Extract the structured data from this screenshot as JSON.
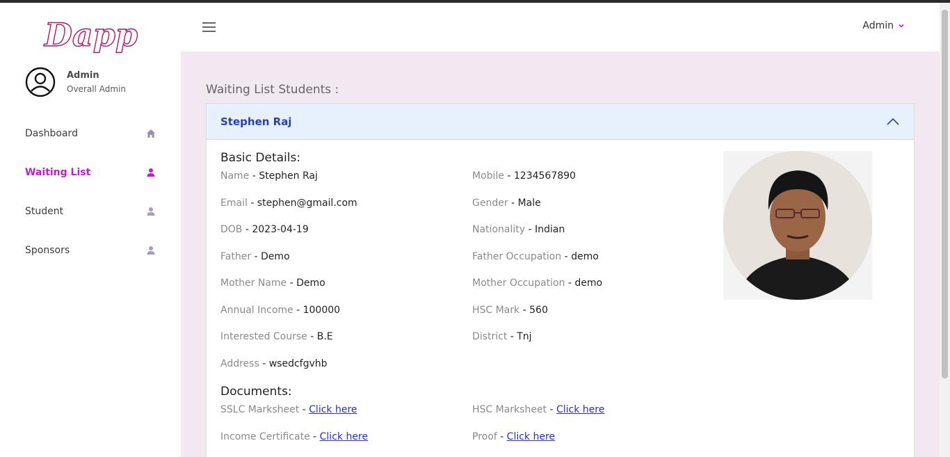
{
  "logo": {
    "text": "Dapp"
  },
  "profile": {
    "name": "Admin",
    "role": "Overall Admin"
  },
  "nav": {
    "items": [
      {
        "label": "Dashboard",
        "icon": "home-icon",
        "active": false
      },
      {
        "label": "Waiting List",
        "icon": "user-icon",
        "active": true
      },
      {
        "label": "Student",
        "icon": "user-icon",
        "active": false
      },
      {
        "label": "Sponsors",
        "icon": "user-icon",
        "active": false
      }
    ]
  },
  "header": {
    "user_label": "Admin"
  },
  "page": {
    "title": "Waiting List Students :"
  },
  "student": {
    "name": "Stephen Raj",
    "basic_title": "Basic Details:",
    "details": [
      {
        "label": "Name",
        "value": "Stephen Raj"
      },
      {
        "label": "Mobile",
        "value": "1234567890"
      },
      {
        "label": "Email",
        "value": "stephen@gmail.com"
      },
      {
        "label": "Gender",
        "value": "Male"
      },
      {
        "label": "DOB",
        "value": "2023-04-19"
      },
      {
        "label": "Nationality",
        "value": "Indian"
      },
      {
        "label": "Father",
        "value": "Demo"
      },
      {
        "label": "Father Occupation",
        "value": "demo"
      },
      {
        "label": "Mother Name",
        "value": "Demo"
      },
      {
        "label": "Mother Occupation",
        "value": "demo"
      },
      {
        "label": "Annual Income",
        "value": "100000"
      },
      {
        "label": "HSC Mark",
        "value": "560"
      },
      {
        "label": "Interested Course",
        "value": "B.E"
      },
      {
        "label": "District",
        "value": "Tnj"
      },
      {
        "label": "Address",
        "value": "wsedcfgvhb"
      }
    ],
    "documents_title": "Documents:",
    "documents": [
      {
        "label": "SSLC Marksheet",
        "link": "Click here"
      },
      {
        "label": "HSC Marksheet",
        "link": "Click here"
      },
      {
        "label": "Income Certificate",
        "link": "Click here"
      },
      {
        "label": "Proof",
        "link": "Click here"
      }
    ]
  },
  "colors": {
    "accent": "#c21bd4",
    "card_header": "#e7f0fd",
    "main_bg": "#f1e8f1",
    "link": "#2b2bd6"
  }
}
